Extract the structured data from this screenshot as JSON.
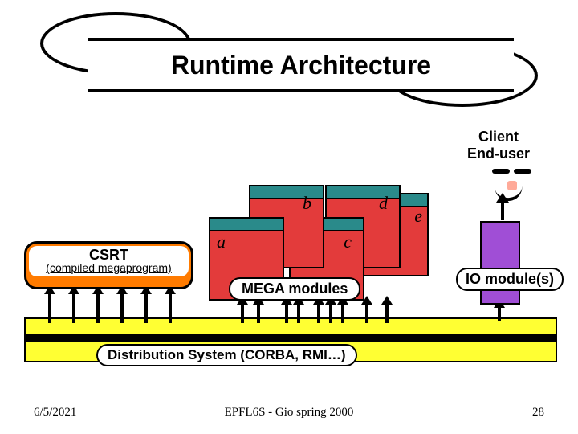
{
  "title": "Runtime Architecture",
  "client_label_line1": "Client",
  "client_label_line2": "End-user",
  "csrt": {
    "title": "CSRT",
    "subtitle": "(compiled megaprogram)"
  },
  "mega_modules": {
    "label": "MEGA modules",
    "items": [
      "a",
      "b",
      "c",
      "d",
      "e"
    ]
  },
  "io_module": {
    "label": "IO module(s)"
  },
  "distribution": {
    "label": "Distribution System (CORBA, RMI…)"
  },
  "footer": {
    "date": "6/5/2021",
    "center": "EPFL6S - Gio spring 2000",
    "page": "28"
  }
}
